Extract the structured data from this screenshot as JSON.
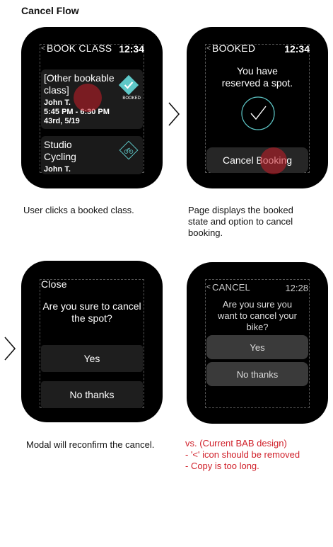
{
  "page": {
    "title": "Cancel Flow"
  },
  "screens": {
    "book_class": {
      "header": "BOOK CLASS",
      "time": "12:34",
      "card1": {
        "title": "[Other bookable class]",
        "instructor": "John T.",
        "time_range": "5:45 PM - 6:30 PM",
        "location_date": "43rd, 5/19",
        "badge": "BOOKED"
      },
      "card2": {
        "title": "Studio Cycling",
        "instructor": "John T."
      },
      "caption": "User clicks a booked class."
    },
    "booked": {
      "header": "BOOKED",
      "time": "12:34",
      "message": "You have reserved a spot.",
      "cancel_button": "Cancel Booking",
      "caption": "Page displays the booked state and option to cancel booking."
    },
    "confirm": {
      "close_label": "Close",
      "question": "Are you sure to cancel the spot?",
      "yes_button": "Yes",
      "no_button": "No thanks",
      "caption": "Modal will reconfirm the cancel."
    },
    "current": {
      "header": "CANCEL",
      "time": "12:28",
      "question": "Are you sure you want to cancel your bike?",
      "yes_button": "Yes",
      "no_button": "No thanks",
      "notes": [
        "vs. (Current BAB design)",
        "- '<' icon should be removed",
        "- Copy is too long."
      ]
    }
  },
  "colors": {
    "accent": "#5ec8c8",
    "tap_marker": "#c81e28",
    "note": "#d0202a"
  }
}
